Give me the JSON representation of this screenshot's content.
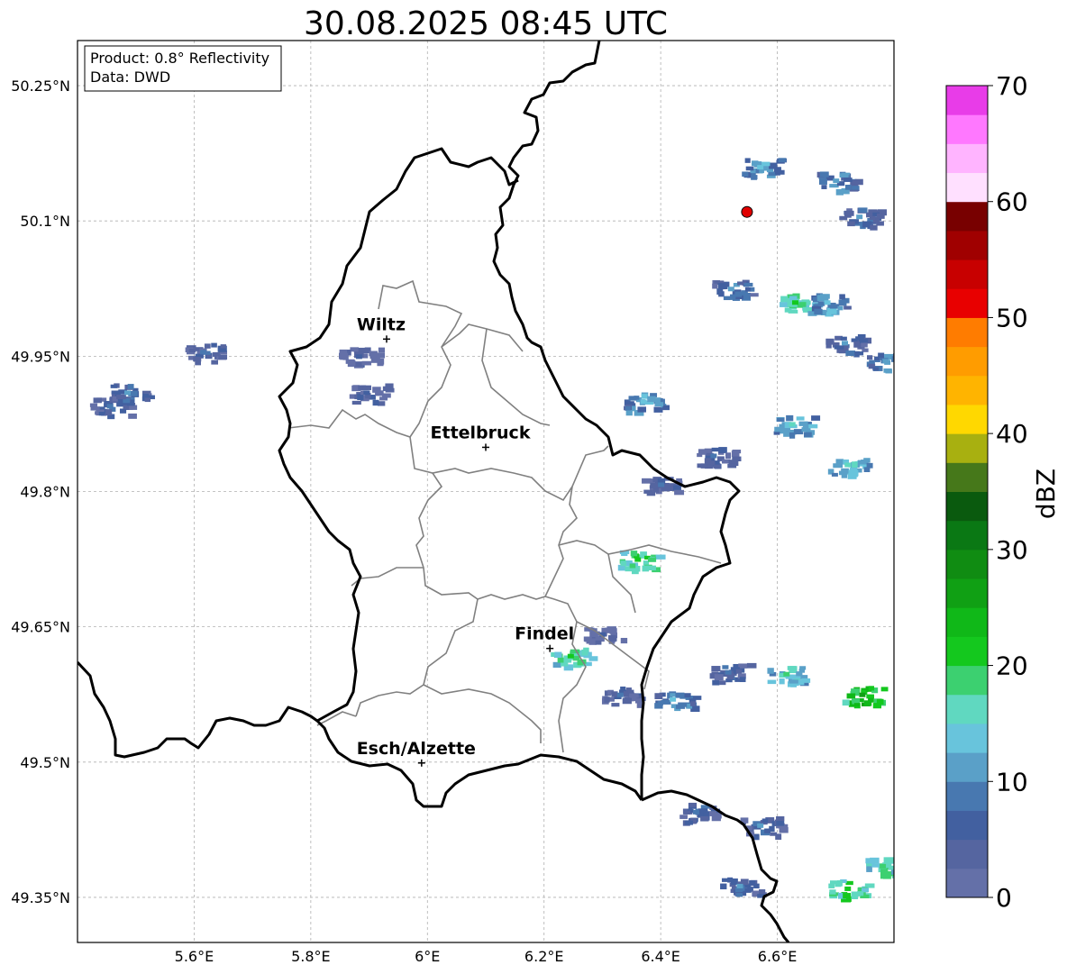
{
  "title": "30.08.2025 08:45 UTC",
  "info_box": {
    "product": "Product: 0.8° Reflectivity",
    "data": "Data: DWD"
  },
  "map": {
    "lon_range": [
      5.4,
      6.8
    ],
    "lat_range": [
      49.3,
      50.3
    ],
    "x_ticks": [
      {
        "value": 5.6,
        "label": "5.6°E"
      },
      {
        "value": 5.8,
        "label": "5.8°E"
      },
      {
        "value": 6.0,
        "label": "6°E"
      },
      {
        "value": 6.2,
        "label": "6.2°E"
      },
      {
        "value": 6.4,
        "label": "6.4°E"
      },
      {
        "value": 6.6,
        "label": "6.6°E"
      }
    ],
    "y_ticks": [
      {
        "value": 49.35,
        "label": "49.35°N"
      },
      {
        "value": 49.5,
        "label": "49.5°N"
      },
      {
        "value": 49.65,
        "label": "49.65°N"
      },
      {
        "value": 49.8,
        "label": "49.8°N"
      },
      {
        "value": 49.95,
        "label": "49.95°N"
      },
      {
        "value": 50.1,
        "label": "50.1°N"
      },
      {
        "value": 50.25,
        "label": "50.25°N"
      }
    ],
    "cities": [
      {
        "name": "Wiltz",
        "lon": 5.93,
        "lat": 49.969
      },
      {
        "name": "Ettelbruck",
        "lon": 6.1,
        "lat": 49.849
      },
      {
        "name": "Findel",
        "lon": 6.21,
        "lat": 49.626
      },
      {
        "name": "Esch/Alzette",
        "lon": 5.99,
        "lat": 49.499
      }
    ],
    "radar_site": {
      "lon": 6.548,
      "lat": 50.11,
      "color": "#e00000"
    },
    "country_border_color": "#000000",
    "canton_border_color": "#808080"
  },
  "colorbar": {
    "label": "dBZ",
    "min": 0,
    "max": 70,
    "ticks": [
      0,
      10,
      20,
      30,
      40,
      50,
      60,
      70
    ],
    "colors": [
      "#6470a8",
      "#5565a0",
      "#4260a0",
      "#4878b0",
      "#5aa0c8",
      "#68c4dc",
      "#60d8c0",
      "#3cd070",
      "#14c81e",
      "#10b818",
      "#10a014",
      "#108c12",
      "#0a7814",
      "#0a5a0e",
      "#46781a",
      "#a8b010",
      "#ffd800",
      "#ffb400",
      "#ff9c00",
      "#ff7c00",
      "#e80000",
      "#c80000",
      "#a00000",
      "#780000",
      "#ffe0ff",
      "#ffb4ff",
      "#ff78ff",
      "#e83ce8"
    ]
  },
  "echo_cells": [
    {
      "lon": 5.455,
      "lat": 49.895,
      "dbz": 9
    },
    {
      "lon": 5.485,
      "lat": 49.91,
      "dbz": 10
    },
    {
      "lon": 5.615,
      "lat": 49.955,
      "dbz": 8
    },
    {
      "lon": 5.882,
      "lat": 49.95,
      "dbz": 6
    },
    {
      "lon": 5.895,
      "lat": 49.91,
      "dbz": 7
    },
    {
      "lon": 6.57,
      "lat": 50.16,
      "dbz": 14
    },
    {
      "lon": 6.7,
      "lat": 50.145,
      "dbz": 12
    },
    {
      "lon": 6.74,
      "lat": 50.105,
      "dbz": 10
    },
    {
      "lon": 6.52,
      "lat": 50.025,
      "dbz": 11
    },
    {
      "lon": 6.63,
      "lat": 50.01,
      "dbz": 20
    },
    {
      "lon": 6.685,
      "lat": 50.01,
      "dbz": 14
    },
    {
      "lon": 6.715,
      "lat": 49.965,
      "dbz": 10
    },
    {
      "lon": 6.785,
      "lat": 49.945,
      "dbz": 12
    },
    {
      "lon": 6.37,
      "lat": 49.9,
      "dbz": 14
    },
    {
      "lon": 6.625,
      "lat": 49.875,
      "dbz": 16
    },
    {
      "lon": 6.72,
      "lat": 49.83,
      "dbz": 17
    },
    {
      "lon": 6.49,
      "lat": 49.84,
      "dbz": 8
    },
    {
      "lon": 6.4,
      "lat": 49.808,
      "dbz": 8
    },
    {
      "lon": 6.36,
      "lat": 49.725,
      "dbz": 22
    },
    {
      "lon": 6.3,
      "lat": 49.642,
      "dbz": 7
    },
    {
      "lon": 6.245,
      "lat": 49.618,
      "dbz": 21
    },
    {
      "lon": 6.515,
      "lat": 49.6,
      "dbz": 9
    },
    {
      "lon": 6.615,
      "lat": 49.598,
      "dbz": 18
    },
    {
      "lon": 6.745,
      "lat": 49.575,
      "dbz": 26
    },
    {
      "lon": 6.42,
      "lat": 49.57,
      "dbz": 13
    },
    {
      "lon": 6.33,
      "lat": 49.575,
      "dbz": 8
    },
    {
      "lon": 6.46,
      "lat": 49.445,
      "dbz": 9
    },
    {
      "lon": 6.57,
      "lat": 49.43,
      "dbz": 10
    },
    {
      "lon": 6.72,
      "lat": 49.36,
      "dbz": 22
    },
    {
      "lon": 6.78,
      "lat": 49.385,
      "dbz": 19
    },
    {
      "lon": 6.535,
      "lat": 49.363,
      "dbz": 10
    }
  ]
}
